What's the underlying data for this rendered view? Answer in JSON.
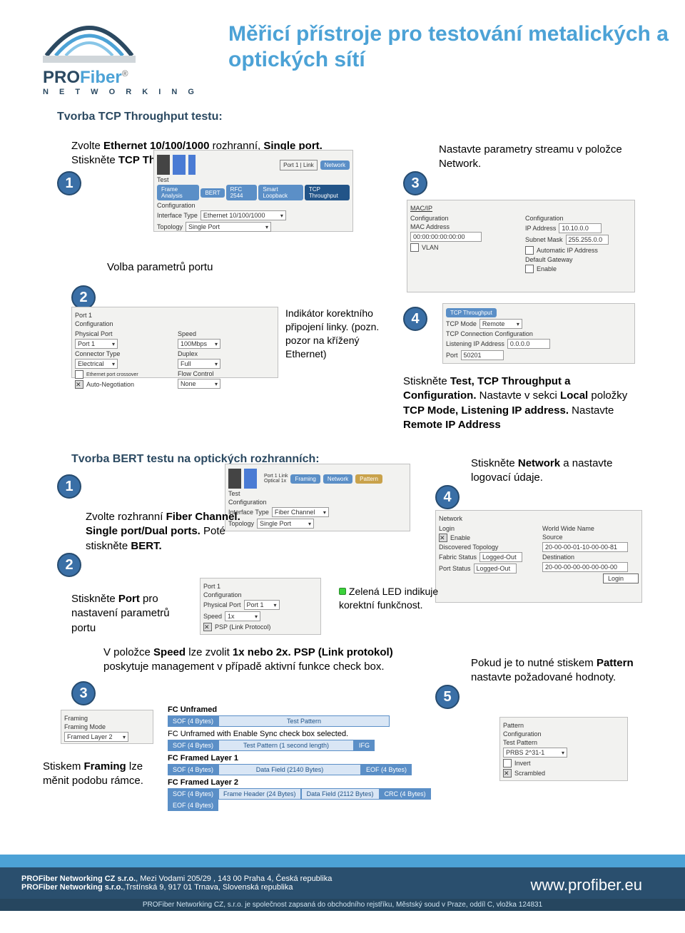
{
  "logo": {
    "pro": "PRO",
    "fiber": "Fiber",
    "r": "®",
    "sub": "N E T W O R K I N G"
  },
  "title": "Měřicí přístroje pro testování metalických a optických sítí",
  "main": {
    "section_title": "Tvorba TCP Throughput testu:",
    "s1": "Zvolte Ethernet 10/100/1000 rozhranní, Single port. Stiskněte TCP Throughput.",
    "s2": "Volba parametrů portu",
    "s3": "Nastavte parametry streamu v položce Network.",
    "s4_prefix": "Indikátor korektního připojení linky. (pozn. pozor na křížený Ethernet)",
    "s4_right": "Stiskněte Test, TCP Throughput a Configuration. Nastavte v sekci Local položky TCP Mode, Listening IP address. Nastavte Remote IP Address",
    "bert_title": "Tvorba BERT testu na optických rozhranních:",
    "b1": "Zvolte rozhranní Fiber Channel. Single port/Dual ports. Poté stiskněte BERT.",
    "b2": "Stiskněte Port pro nastavení parametrů portu",
    "b2_note": "Zelená LED indikuje korektní funkčnost.",
    "b3": "V položce Speed lze zvolit 1x nebo 2x. PSP (Link protokol) poskytuje management v případě aktivní funkce check box.",
    "b4": "Stiskněte Network a nastavte logovací údaje.",
    "b5": "Pokud je to nutné stiskem Pattern nastavte požadované hodnoty.",
    "bfr": "Stiskem Framing lze měnit podobu rámce."
  },
  "shots": {
    "frame_analysis": "Frame Analysis",
    "bert": "BERT",
    "rfc": "RFC 2544",
    "smart": "Smart Loopback",
    "tcp": "TCP Throughput",
    "config": "Configuration",
    "iftype": "Interface Type",
    "ethx": "Ethernet 10/100/1000",
    "topology": "Topology",
    "single": "Single Port",
    "port1": "Port 1",
    "physport": "Physical Port",
    "speed": "Speed",
    "speed100": "100Mbps",
    "conntype": "Connector Type",
    "electrical": "Electrical",
    "duplex": "Duplex",
    "full": "Full",
    "flowctl": "Flow Control",
    "none": "None",
    "ethcross": "Ethernet port crossover",
    "autoneg": "Auto-Negotiation",
    "macip": "MAC/IP",
    "mac": "MAC Address",
    "mac0": "00:00:00:00:00:00",
    "vlan": "VLAN",
    "ipaddr": "IP Address",
    "ip0": "10.10.0.0",
    "submask": "Subnet Mask",
    "sm0": "255.255.0.0",
    "autoip": "Automatic IP Address",
    "defgw": "Default Gateway",
    "enable": "Enable",
    "tcpthru": "TCP Throughput",
    "tcpmode": "TCP Mode",
    "remote": "Remote",
    "tcpconn": "TCP Connection Configuration",
    "listenip": "Listening IP Address",
    "listenip_v": "0.0.0.0",
    "port": "Port",
    "port_v": "50201",
    "test": "Test",
    "fiber": "Fiber Channel",
    "network": "Network",
    "login": "Login",
    "wwn": "World Wide Name",
    "source": "Source",
    "dest": "Destination",
    "src_v": "20-00-00-01-10-00-00-81",
    "dst_v": "20-00-00-00-00-00-00-00",
    "disc_topo": "Discovered Topology",
    "fabric": "Fabric Status",
    "loggedo": "Logged-Out",
    "pstatus": "Port Status",
    "loginb": "Login",
    "psp": "PSP (Link Protocol)",
    "x1": "1x",
    "pattern": "Pattern",
    "tpattern": "Test Pattern",
    "prbs": "PRBS 2^31-1",
    "invert": "Invert",
    "scramble": "Scrambled",
    "framing": "Framing",
    "fmode": "Framing Mode",
    "framed2": "Framed Layer 2",
    "fc_unframed": "FC Unframed",
    "fc_unframed_sync": "FC Unframed with Enable Sync check box selected.",
    "fc_layer1": "FC Framed Layer 1",
    "fc_layer2": "FC Framed Layer 2",
    "sof": "SOF (4 Bytes)",
    "testpattern": "Test Pattern",
    "tp1sec": "Test Pattern (1 second length)",
    "ifg": "IFG",
    "datafield": "Data Field (2140 Bytes)",
    "frameheader": "Frame Header (24 Bytes)",
    "datafield2": "Data Field (2112 Bytes)",
    "crc": "CRC (4 Bytes)",
    "eof": "EOF (4 Bytes)"
  },
  "badges": {
    "n1": "1",
    "n2": "2",
    "n3": "3",
    "n4": "4",
    "n5": "5"
  },
  "footer": {
    "cz": "PROFiber Networking CZ  s.r.o., Mezi Vodami 205/29 , 143 00 Praha 4, Česká republika",
    "sk": "PROFiber Networking  s.r.o.,Trstínská  9, 917 01 Trnava, Slovenská republika",
    "url": "www.profiber.eu",
    "legal": "PROFiber Networking CZ, s.r.o. je společnost zapsaná do obchodního rejstříku, Městský soud v Praze, oddíl C, vložka 124831"
  }
}
